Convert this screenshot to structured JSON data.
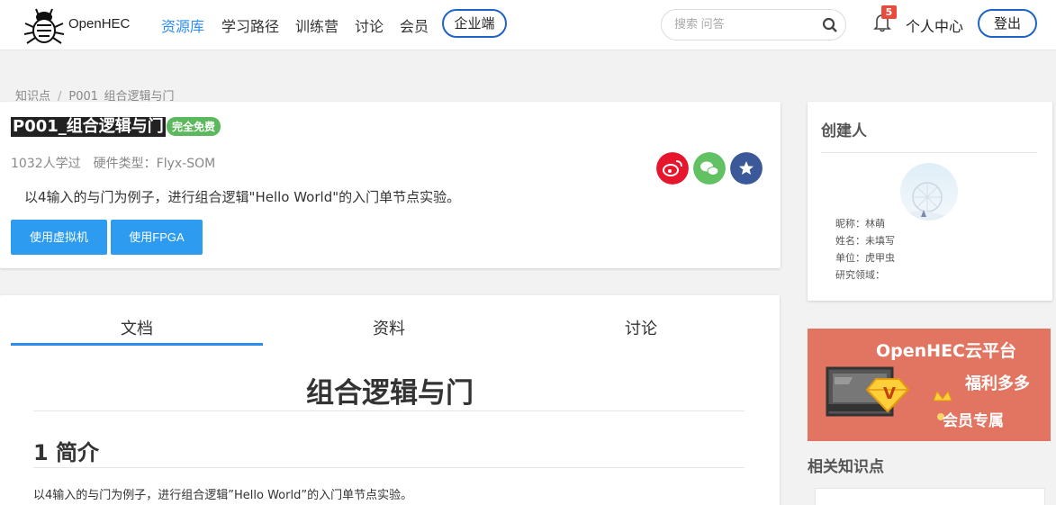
{
  "nav": {
    "brand": "OpenHEC",
    "items": [
      "资源库",
      "学习路径",
      "训练营",
      "讨论",
      "会员"
    ],
    "enterprise": "企业端",
    "search_placeholder": "搜索 问答",
    "notification_count": "5",
    "user_center": "个人中心",
    "logout": "登出"
  },
  "breadcrumb": {
    "root": "知识点",
    "separator": "/",
    "current": "P001_组合逻辑与门"
  },
  "knowledge": {
    "title": "P001_组合逻辑与门",
    "badge": "完全免费",
    "learners": "1032人学过",
    "hardware": "硬件类型：Flyx-SOM",
    "description": "以4输入的与门为例子，进行组合逻辑\"Hello World\"的入门单节点实验。",
    "btn_vm": "使用虚拟机",
    "btn_fpga": "使用FPGA"
  },
  "creator": {
    "title": "创建人",
    "nickname": "昵称：林萌",
    "name": "姓名：未填写",
    "org": "单位：虎甲虫",
    "field": "研究领域："
  },
  "ad": {
    "title": "OpenHEC云平台",
    "line1": "福利多多",
    "line2": "会员专属",
    "badge": "V"
  },
  "related": {
    "title": "相关知识点"
  },
  "doc": {
    "tabs": [
      "文档",
      "资料",
      "讨论"
    ],
    "h1": "组合逻辑与门",
    "h2": "1 简介",
    "p": "以4输入的与门为例子，进行组合逻辑”Hello World”的入门单节点实验。"
  },
  "colors": {
    "accent": "#2d8cf0",
    "button": "#2d9cf0",
    "badge_green": "#5cb85c",
    "weibo": "#e6162d",
    "wechat": "#62c162",
    "favorite": "#3b5998",
    "ad_bg": "#e27561"
  }
}
